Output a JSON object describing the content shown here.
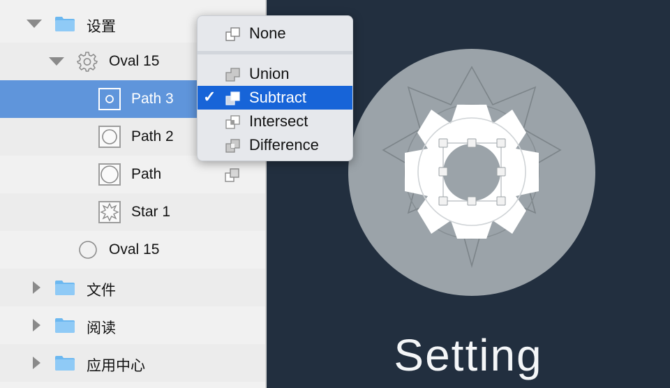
{
  "layers": {
    "groups": [
      {
        "label": "设置",
        "expanded": true
      },
      {
        "label": "文件",
        "expanded": false
      },
      {
        "label": "阅读",
        "expanded": false
      },
      {
        "label": "应用中心",
        "expanded": false
      }
    ],
    "oval_group": {
      "label": "Oval 15",
      "icon": "gear-icon"
    },
    "paths": [
      {
        "label": "Path 3",
        "selected": true
      },
      {
        "label": "Path 2",
        "selected": false
      },
      {
        "label": "Path",
        "selected": false
      },
      {
        "label": "Star 1",
        "selected": false
      }
    ],
    "oval_shape": {
      "label": "Oval 15",
      "icon": "circle-icon"
    }
  },
  "boolean_menu": {
    "items": [
      {
        "label": "None",
        "icon": "boolean-none-icon"
      },
      {
        "label": "Union",
        "icon": "boolean-union-icon"
      },
      {
        "label": "Subtract",
        "icon": "boolean-subtract-icon",
        "checked": true
      },
      {
        "label": "Intersect",
        "icon": "boolean-intersect-icon"
      },
      {
        "label": "Difference",
        "icon": "boolean-difference-icon"
      }
    ],
    "check_mark": "✓"
  },
  "canvas": {
    "artboard_title": "Setting"
  },
  "colors": {
    "sidebar_bg": "#f1f1f1",
    "selection": "#5f95db",
    "canvas_bg": "#222f3f",
    "menu_highlight": "#1764d8",
    "folder": "#6cb8f0",
    "circle": "#9ba3a9"
  }
}
